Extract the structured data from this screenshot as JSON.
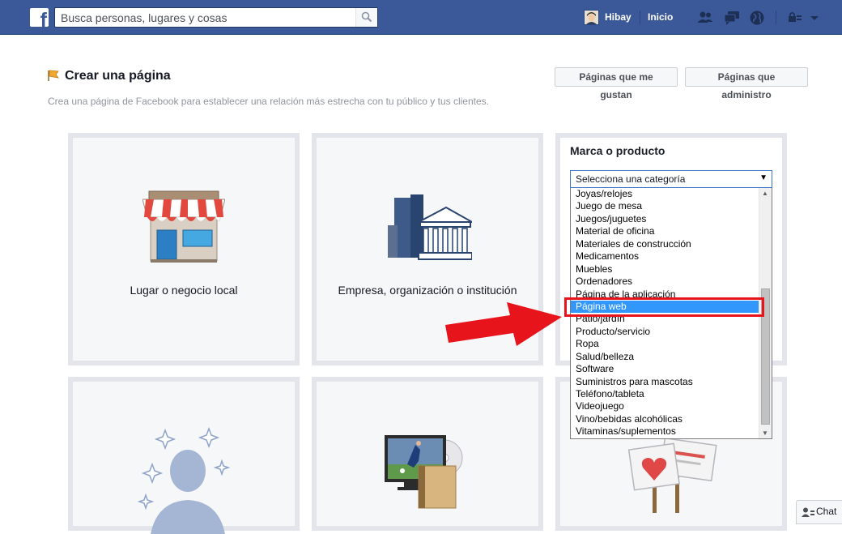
{
  "topbar": {
    "logo_letter": "f",
    "search_placeholder": "Busca personas, lugares y cosas",
    "user_name": "Hibay",
    "home_label": "Inicio",
    "icons": [
      "friend-requests-icon",
      "messages-icon",
      "notifications-globe-icon",
      "privacy-shortcuts-icon",
      "account-menu-chevron-icon"
    ]
  },
  "header": {
    "title": "Crear una página",
    "subtitle": "Crea una página de Facebook para establecer una relación más estrecha con tu público y tus clientes.",
    "liked_pages_button": "Páginas que me gustan",
    "managed_pages_button": "Páginas que administro"
  },
  "tiles": [
    {
      "label": "Lugar o negocio local",
      "icon": "storefront-icon"
    },
    {
      "label": "Empresa, organización o institución",
      "icon": "buildings-icon"
    },
    {
      "label": "",
      "icon": "public-figure-icon"
    },
    {
      "label": "",
      "icon": "entertainment-icon"
    },
    {
      "label": "",
      "icon": "cause-community-icon"
    }
  ],
  "brand_card": {
    "title": "Marca o producto",
    "select_value": "Selecciona una categoría",
    "options": [
      "Joyas/relojes",
      "Juego de mesa",
      "Juegos/juguetes",
      "Material de oficina",
      "Materiales de construcción",
      "Medicamentos",
      "Muebles",
      "Ordenadores",
      "Página de la aplicación",
      "Página web",
      "Patio/jardín",
      "Producto/servicio",
      "Ropa",
      "Salud/belleza",
      "Software",
      "Suministros para mascotas",
      "Teléfono/tableta",
      "Videojuego",
      "Vino/bebidas alcohólicas",
      "Vitaminas/suplementos"
    ],
    "selected_option": "Página web"
  },
  "chat": {
    "label": "Chat"
  },
  "colors": {
    "topbar": "#3b5998",
    "selected_option": "#3297fd",
    "annotation_red": "#e8141b"
  }
}
